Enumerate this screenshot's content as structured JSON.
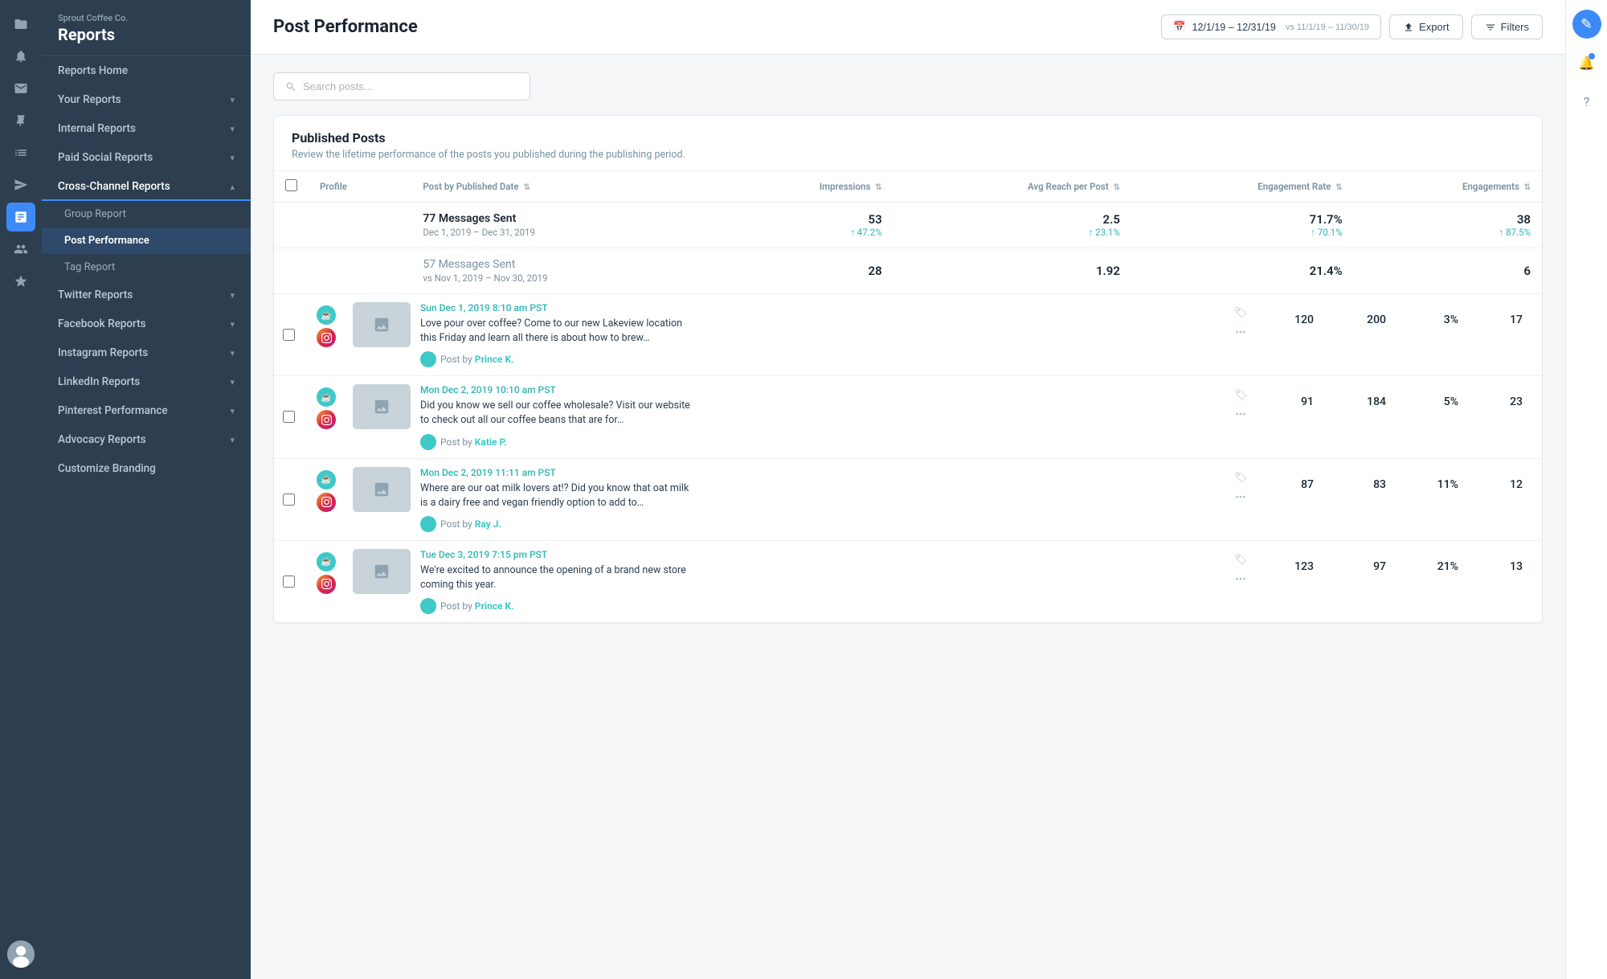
{
  "brand": {
    "company": "Sprout Coffee Co.",
    "title": "Reports"
  },
  "sidebar": {
    "nav_items": [
      {
        "id": "reports-home",
        "label": "Reports Home",
        "expandable": false
      },
      {
        "id": "your-reports",
        "label": "Your Reports",
        "expandable": true
      },
      {
        "id": "internal-reports",
        "label": "Internal Reports",
        "expandable": true
      },
      {
        "id": "paid-social-reports",
        "label": "Paid Social Reports",
        "expandable": true
      },
      {
        "id": "cross-channel-reports",
        "label": "Cross-Channel Reports",
        "expandable": true,
        "active": true
      },
      {
        "id": "twitter-reports",
        "label": "Twitter Reports",
        "expandable": true
      },
      {
        "id": "facebook-reports",
        "label": "Facebook Reports",
        "expandable": true
      },
      {
        "id": "instagram-reports",
        "label": "Instagram Reports",
        "expandable": true
      },
      {
        "id": "linkedin-reports",
        "label": "LinkedIn Reports",
        "expandable": true
      },
      {
        "id": "pinterest-performance",
        "label": "Pinterest Performance",
        "expandable": true
      },
      {
        "id": "advocacy-reports",
        "label": "Advocacy Reports",
        "expandable": true
      },
      {
        "id": "customize-branding",
        "label": "Customize Branding",
        "expandable": false
      }
    ],
    "sub_items": [
      {
        "id": "group-report",
        "label": "Group Report"
      },
      {
        "id": "post-performance",
        "label": "Post Performance",
        "active": true
      },
      {
        "id": "tag-report",
        "label": "Tag Report"
      }
    ]
  },
  "header": {
    "title": "Post Performance",
    "date_range": "12/1/19 – 12/31/19",
    "vs_label": "vs 11/1/19 – 11/30/19",
    "export_label": "Export",
    "filters_label": "Filters",
    "calendar_icon": "📅",
    "export_icon": "↑",
    "filters_icon": "⚙"
  },
  "search": {
    "placeholder": "Search posts..."
  },
  "published_posts": {
    "title": "Published Posts",
    "description": "Review the lifetime performance of the posts you published during the publishing period.",
    "table": {
      "columns": [
        {
          "id": "profile",
          "label": "Profile"
        },
        {
          "id": "post-date",
          "label": "Post by Published Date"
        },
        {
          "id": "impressions",
          "label": "Impressions"
        },
        {
          "id": "avg-reach",
          "label": "Avg Reach per Post"
        },
        {
          "id": "engagement-rate",
          "label": "Engagement Rate"
        },
        {
          "id": "engagements",
          "label": "Engagements"
        }
      ],
      "summary_current": {
        "messages": "77 Messages Sent",
        "period": "Dec 1, 2019 – Dec 31, 2019",
        "impressions": "53",
        "impressions_delta": "↑ 47.2%",
        "avg_reach": "2.5",
        "avg_reach_delta": "↑ 23.1%",
        "engagement_rate": "71.7%",
        "engagement_rate_delta": "↑ 70.1%",
        "engagements": "38",
        "engagements_delta": "↑ 87.5%"
      },
      "summary_previous": {
        "messages": "57 Messages Sent",
        "period": "vs Nov 1, 2019 – Nov 30, 2019",
        "impressions": "28",
        "avg_reach": "1.92",
        "engagement_rate": "21.4%",
        "engagements": "6"
      },
      "posts": [
        {
          "id": "post-1",
          "time": "Sun Dec 1, 2019 8:10 am PST",
          "body": "Love pour over coffee? Come to our new Lakeview location this Friday and learn all there is about how to brew…",
          "author": "Prince K.",
          "impressions": "120",
          "avg_reach": "200",
          "engagement_rate": "3%",
          "engagements": "17",
          "thumb_emoji": "🖼"
        },
        {
          "id": "post-2",
          "time": "Mon Dec 2, 2019 10:10 am PST",
          "body": "Did you know we sell our coffee wholesale? Visit our website to check out all our coffee beans that are for…",
          "author": "Katie P.",
          "impressions": "91",
          "avg_reach": "184",
          "engagement_rate": "5%",
          "engagements": "23",
          "thumb_emoji": "🖼"
        },
        {
          "id": "post-3",
          "time": "Mon Dec 2, 2019 11:11 am PST",
          "body": "Where are our oat milk lovers at!? Did you know that oat milk is a dairy free and vegan friendly option to add to…",
          "author": "Ray J.",
          "impressions": "87",
          "avg_reach": "83",
          "engagement_rate": "11%",
          "engagements": "12",
          "thumb_emoji": "🖼"
        },
        {
          "id": "post-4",
          "time": "Tue Dec 3, 2019 7:15 pm PST",
          "body": "We're excited to announce the opening of a brand new store coming this year.",
          "author": "Prince K.",
          "impressions": "123",
          "avg_reach": "97",
          "engagement_rate": "21%",
          "engagements": "13",
          "thumb_emoji": "🖼"
        }
      ]
    }
  },
  "right_panel": {
    "compose_label": "✎",
    "notification_label": "🔔",
    "help_label": "?"
  }
}
